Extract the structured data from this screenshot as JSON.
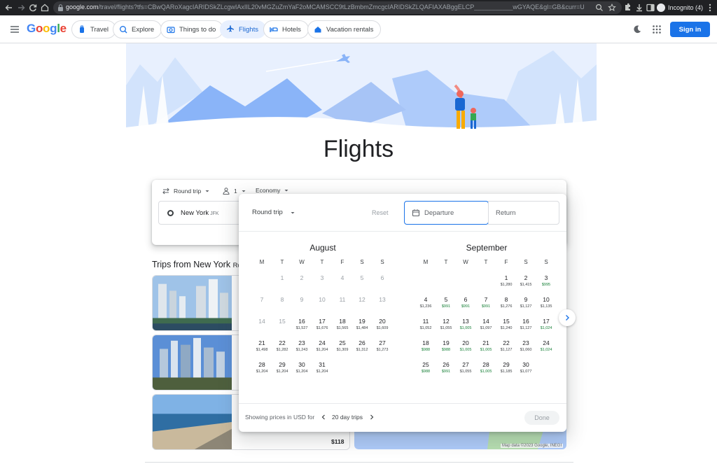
{
  "browser": {
    "url_host": "google.com",
    "url_rest": "/travel/flights?tfs=CBwQARoXagcIARIDSkZLcgwIAxIIL20vMGZuZmYaF2oMCAMSCC9tLzBmbmZmcgcIARIDSkZLQAFIAXABggELCP___________wGYAQE&gl=GB&curr=USD",
    "incognito_label": "Incognito (4)"
  },
  "header": {
    "logo": "Google",
    "logo_colors": [
      "#4285f4",
      "#ea4335",
      "#fbbc05",
      "#4285f4",
      "#34a853",
      "#ea4335"
    ],
    "nav": [
      "Travel",
      "Explore",
      "Things to do",
      "Flights",
      "Hotels",
      "Vacation rentals"
    ],
    "active_nav": "Flights",
    "signin_label": "Sign in"
  },
  "hero": {
    "title": "Flights"
  },
  "search": {
    "trip_type": "Round trip",
    "passengers": "1",
    "cabin": "Economy",
    "origin": "New York",
    "origin_code": "JFK"
  },
  "trips": {
    "title": "Trips from New York",
    "title_suffix": "Ro",
    "price": "$118",
    "map_attribution": "Map data ©2023 Google, INEGI"
  },
  "picker": {
    "trip_type": "Round trip",
    "reset_label": "Reset",
    "departure_placeholder": "Departure",
    "return_placeholder": "Return",
    "weekdays": [
      "M",
      "T",
      "W",
      "T",
      "F",
      "S",
      "S"
    ],
    "months": [
      {
        "name": "August",
        "weeks": [
          [
            null,
            {
              "d": "1",
              "m": true
            },
            {
              "d": "2",
              "m": true
            },
            {
              "d": "3",
              "m": true
            },
            {
              "d": "4",
              "m": true
            },
            {
              "d": "5",
              "m": true
            },
            {
              "d": "6",
              "m": true
            }
          ],
          [
            {
              "d": "7",
              "m": true
            },
            {
              "d": "8",
              "m": true
            },
            {
              "d": "9",
              "m": true
            },
            {
              "d": "10",
              "m": true
            },
            {
              "d": "11",
              "m": true
            },
            {
              "d": "12",
              "m": true
            },
            {
              "d": "13",
              "m": true
            }
          ],
          [
            {
              "d": "14",
              "m": true
            },
            {
              "d": "15",
              "m": true
            },
            {
              "d": "16",
              "p": "$1,527"
            },
            {
              "d": "17",
              "p": "$1,676"
            },
            {
              "d": "18",
              "p": "$1,565"
            },
            {
              "d": "19",
              "p": "$1,484"
            },
            {
              "d": "20",
              "p": "$1,609"
            }
          ],
          [
            {
              "d": "21",
              "p": "$1,498"
            },
            {
              "d": "22",
              "p": "$1,282"
            },
            {
              "d": "23",
              "p": "$1,243"
            },
            {
              "d": "24",
              "p": "$1,204"
            },
            {
              "d": "25",
              "p": "$1,309"
            },
            {
              "d": "26",
              "p": "$1,312"
            },
            {
              "d": "27",
              "p": "$1,273"
            }
          ],
          [
            {
              "d": "28",
              "p": "$1,204"
            },
            {
              "d": "29",
              "p": "$1,204"
            },
            {
              "d": "30",
              "p": "$1,204"
            },
            {
              "d": "31",
              "p": "$1,204"
            },
            null,
            null,
            null
          ]
        ]
      },
      {
        "name": "September",
        "weeks": [
          [
            null,
            null,
            null,
            null,
            {
              "d": "1",
              "p": "$1,280"
            },
            {
              "d": "2",
              "p": "$1,415"
            },
            {
              "d": "3",
              "p": "$995",
              "low": true
            }
          ],
          [
            {
              "d": "4",
              "p": "$1,236"
            },
            {
              "d": "5",
              "p": "$991",
              "low": true
            },
            {
              "d": "6",
              "p": "$991",
              "low": true
            },
            {
              "d": "7",
              "p": "$991",
              "low": true
            },
            {
              "d": "8",
              "p": "$1,276"
            },
            {
              "d": "9",
              "p": "$1,127"
            },
            {
              "d": "10",
              "p": "$1,135"
            }
          ],
          [
            {
              "d": "11",
              "p": "$1,052"
            },
            {
              "d": "12",
              "p": "$1,055"
            },
            {
              "d": "13",
              "p": "$1,005",
              "low": true
            },
            {
              "d": "14",
              "p": "$1,097"
            },
            {
              "d": "15",
              "p": "$1,240"
            },
            {
              "d": "16",
              "p": "$1,127"
            },
            {
              "d": "17",
              "p": "$1,024",
              "low": true
            }
          ],
          [
            {
              "d": "18",
              "p": "$988",
              "low": true
            },
            {
              "d": "19",
              "p": "$988",
              "low": true
            },
            {
              "d": "20",
              "p": "$1,005",
              "low": true
            },
            {
              "d": "21",
              "p": "$1,005",
              "low": true
            },
            {
              "d": "22",
              "p": "$1,127"
            },
            {
              "d": "23",
              "p": "$1,060"
            },
            {
              "d": "24",
              "p": "$1,024",
              "low": true
            }
          ],
          [
            {
              "d": "25",
              "p": "$988",
              "low": true
            },
            {
              "d": "26",
              "p": "$991",
              "low": true
            },
            {
              "d": "27",
              "p": "$1,055"
            },
            {
              "d": "28",
              "p": "$1,005",
              "low": true
            },
            {
              "d": "29",
              "p": "$1,185"
            },
            {
              "d": "30",
              "p": "$1,077"
            },
            null
          ]
        ]
      }
    ],
    "showing_text": "Showing prices in USD for",
    "trip_length": "20 day trips",
    "done_label": "Done"
  }
}
